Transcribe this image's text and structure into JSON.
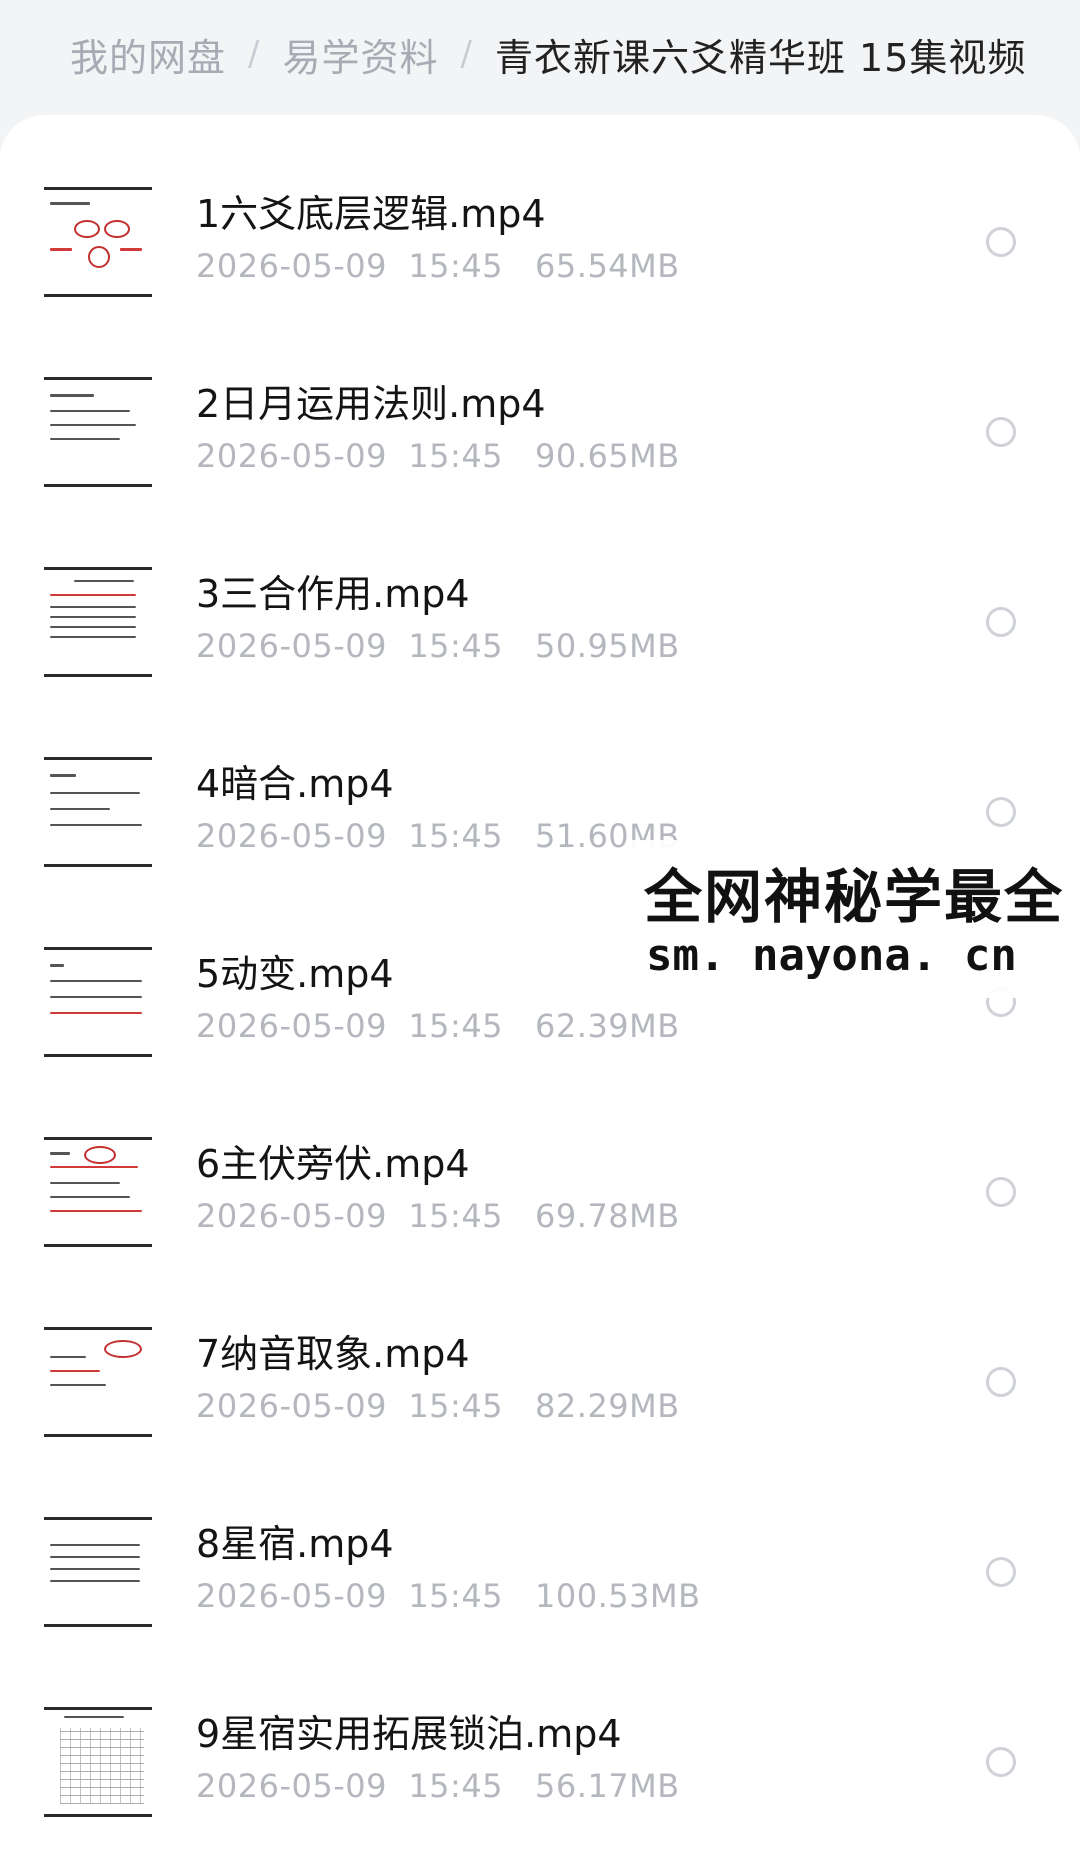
{
  "breadcrumb": [
    "我的网盘",
    "易学资料",
    "青衣新课六爻精华班 15集视频"
  ],
  "separator": "/",
  "files": [
    {
      "name": "1六爻底层逻辑.mp4",
      "meta": "2026-05-09  15:45   65.54MB"
    },
    {
      "name": "2日月运用法则.mp4",
      "meta": "2026-05-09  15:45   90.65MB"
    },
    {
      "name": "3三合作用.mp4",
      "meta": "2026-05-09  15:45   50.95MB"
    },
    {
      "name": "4暗合.mp4",
      "meta": "2026-05-09  15:45   51.60MB"
    },
    {
      "name": "5动变.mp4",
      "meta": "2026-05-09  15:45   62.39MB"
    },
    {
      "name": "6主伏旁伏.mp4",
      "meta": "2026-05-09  15:45   69.78MB"
    },
    {
      "name": "7纳音取象.mp4",
      "meta": "2026-05-09  15:45   82.29MB"
    },
    {
      "name": "8星宿.mp4",
      "meta": "2026-05-09  15:45   100.53MB"
    },
    {
      "name": "9星宿实用拓展锁泊.mp4",
      "meta": "2026-05-09  15:45   56.17MB"
    }
  ],
  "watermark": {
    "line1": "全网神秘学最全",
    "line2": "sm. nayona. cn"
  }
}
